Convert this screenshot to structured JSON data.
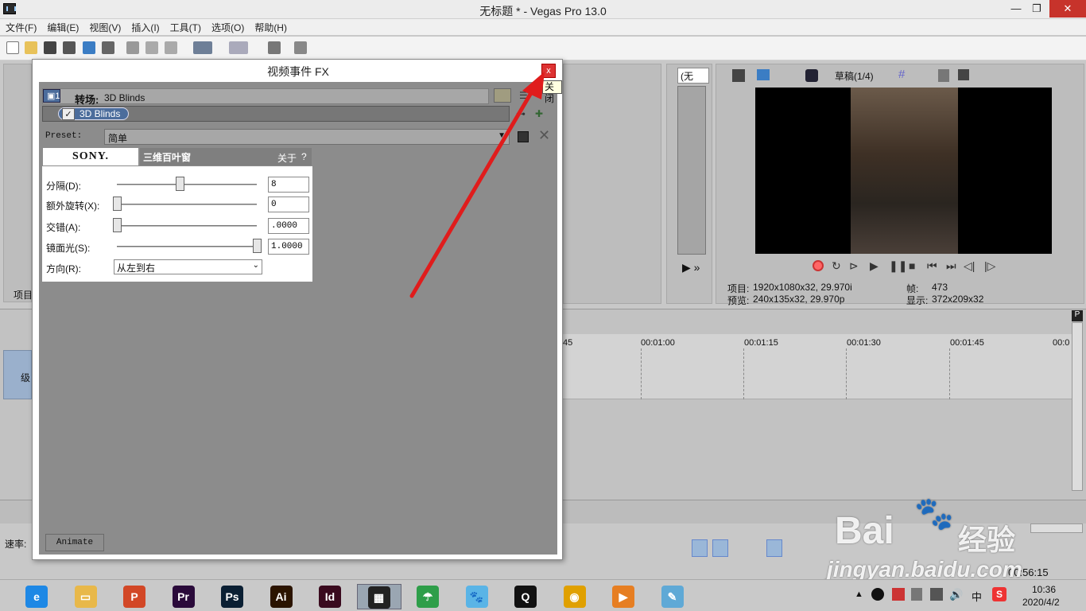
{
  "window": {
    "title": "无标题 * - Vegas Pro 13.0",
    "minimize": "—",
    "maximize": "❐",
    "close": "✕"
  },
  "menu": [
    "文件(F)",
    "编辑(E)",
    "视图(V)",
    "插入(I)",
    "工具(T)",
    "选项(O)",
    "帮助(H)"
  ],
  "dialog": {
    "title": "视频事件 FX",
    "close_glyph": "x",
    "close_tooltip": "关闭",
    "chain_index": "1",
    "transition_label": "转场:",
    "transition_name": "3D Blinds",
    "fx_tab": "3D Blinds",
    "preset_label": "Preset:",
    "preset_value": "简单",
    "plugin": {
      "brand": "SONY.",
      "name": "三维百叶窗",
      "about": "关于",
      "help": "?",
      "params": [
        {
          "label": "分隔(D):",
          "value": "8",
          "level": 0.45
        },
        {
          "label": "额外旋转(X):",
          "value": "0",
          "level": 0.0
        },
        {
          "label": "交错(A):",
          "value": ".0000",
          "level": 0.0
        },
        {
          "label": "镜面光(S):",
          "value": "1.0000",
          "level": 1.0
        }
      ],
      "direction_label": "方向(R):",
      "direction_value": "从左到右"
    },
    "animate_button": "Animate"
  },
  "preview": {
    "quality": "草稿(1/4)",
    "project_label": "项目:",
    "project_value": "1920x1080x32, 29.970i",
    "preview_label": "预览:",
    "preview_value": "240x135x32, 29.970p",
    "frame_label": "帧:",
    "frame_value": "473",
    "display_label": "显示:",
    "display_value": "372x209x32"
  },
  "trimmer": {
    "dropdown": "(无"
  },
  "left_panel": {
    "tab_label": "项目"
  },
  "track": {
    "label": "级"
  },
  "timeline": {
    "ruler": [
      "45",
      "00:01:00",
      "00:01:15",
      "00:01:30",
      "00:01:45",
      "00:0"
    ],
    "speed_label": "速率:",
    "time_display": "00:56:15"
  },
  "watermark": {
    "logo_text": "Bai",
    "logo_suffix": "经验",
    "site": "jingyan.baidu.com"
  },
  "tray": {
    "ime": "中",
    "time": "10:36",
    "date": "2020/4/2"
  },
  "taskbar": [
    {
      "name": "ie",
      "glyph": "e",
      "color": "#1e88e5"
    },
    {
      "name": "explorer",
      "glyph": "▭",
      "color": "#e8b84a"
    },
    {
      "name": "powerpoint",
      "glyph": "P",
      "color": "#d24726"
    },
    {
      "name": "premiere",
      "glyph": "Pr",
      "color": "#2a0a3a"
    },
    {
      "name": "photoshop",
      "glyph": "Ps",
      "color": "#0a1f33"
    },
    {
      "name": "illustrator",
      "glyph": "Ai",
      "color": "#2b1400"
    },
    {
      "name": "indesign",
      "glyph": "Id",
      "color": "#3a0a1e"
    },
    {
      "name": "vegas",
      "glyph": "▦",
      "color": "#222222"
    },
    {
      "name": "umbrella-app",
      "glyph": "☂",
      "color": "#2e9e49"
    },
    {
      "name": "cat-app",
      "glyph": "🐾",
      "color": "#5ab4e6"
    },
    {
      "name": "qq",
      "glyph": "Q",
      "color": "#111111"
    },
    {
      "name": "chrome",
      "glyph": "◉",
      "color": "#e0a000"
    },
    {
      "name": "player",
      "glyph": "▶",
      "color": "#e67e22"
    },
    {
      "name": "notes",
      "glyph": "✎",
      "color": "#5fa9d6"
    }
  ]
}
